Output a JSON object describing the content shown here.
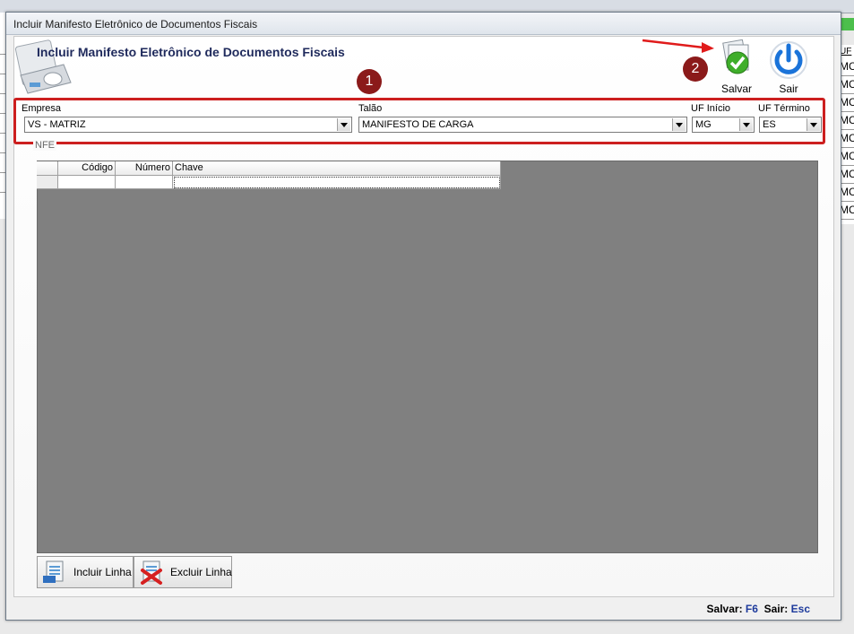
{
  "window": {
    "title": "Incluir Manifesto Eletrônico de Documentos Fiscais",
    "header_title": "Incluir Manifesto Eletrônico de Documentos Fiscais"
  },
  "toolbar": {
    "save_label": "Salvar",
    "exit_label": "Sair"
  },
  "callouts": {
    "one": "1",
    "two": "2"
  },
  "form": {
    "empresa_label": "Empresa",
    "empresa_value": "VS - MATRIZ",
    "talao_label": "Talão",
    "talao_value": "MANIFESTO DE CARGA",
    "uf_inicio_label": "UF Início",
    "uf_inicio_value": "MG",
    "uf_termino_label": "UF Término",
    "uf_termino_value": "ES"
  },
  "nfe": {
    "group_label": "NFE",
    "columns": [
      "Código",
      "Número",
      "Chave"
    ]
  },
  "buttons": {
    "add_row": "Incluir Linha",
    "remove_row": "Excluir Linha"
  },
  "status": {
    "save_label": "Salvar:",
    "save_key": "F6",
    "exit_label": "Sair:",
    "exit_key": "Esc"
  },
  "background": {
    "uf_header": "UF",
    "uf_cells": [
      "MC",
      "MC",
      "MC",
      "MC",
      "MC",
      "MC",
      "MC",
      "MC",
      "MC"
    ]
  },
  "colors": {
    "highlight": "#cc1f1f",
    "callout": "#8b1a1a",
    "grid_background": "#808080",
    "title_text": "#1f2a5c",
    "shortcut_key": "#1d3a9c"
  }
}
